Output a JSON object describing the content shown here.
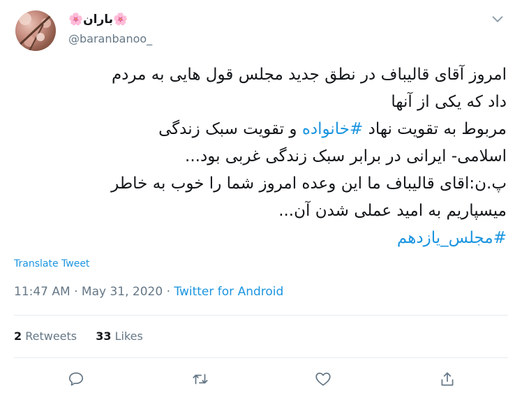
{
  "author": {
    "display_name": "🌸باران🌸",
    "username": "@baranbanoo_"
  },
  "tweet": {
    "lines": [
      "امروز آقای قالیباف در نطق جدید مجلس قول هایی به مردم",
      "داد که یکی از آنها",
      "مربوط به تقویت نهاد ",
      "اسلامی- ایرانی در برابر سبک زندگی غربی بود...",
      "پ.ن:اقای قالیباف ما این وعده امروز شما را خوب به خاطر",
      "میسپاریم به امید عملی شدن آن..."
    ],
    "hashtag_family": "#خانواده",
    "line3_tail": " و تقویت سبک زندگی",
    "hashtag_final": "#مجلس_یازدهم"
  },
  "translate_label": "Translate Tweet",
  "meta": {
    "time": "11:47 AM",
    "separator1": " · ",
    "date": "May 31, 2020",
    "separator2": " · ",
    "source": "Twitter for Android"
  },
  "stats": {
    "retweets_count": "2",
    "retweets_label": "Retweets",
    "likes_count": "33",
    "likes_label": "Likes"
  },
  "icons": {
    "caret": "chevron-down-icon",
    "reply": "reply-icon",
    "retweet": "retweet-icon",
    "like": "heart-icon",
    "share": "share-icon"
  },
  "colors": {
    "link": "#1b95e0",
    "secondary": "#657786",
    "divider": "#e6ecf0",
    "text": "#14171a"
  }
}
